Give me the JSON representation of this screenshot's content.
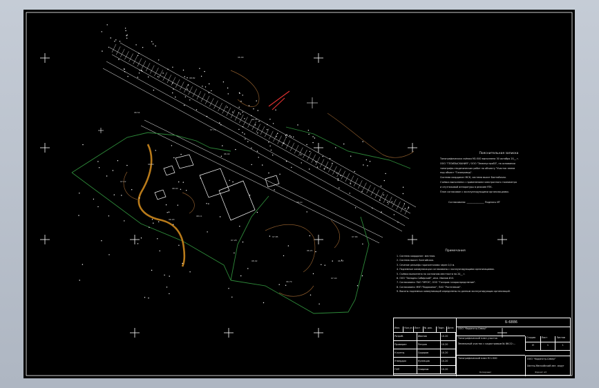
{
  "drawing": {
    "sheet_number": "Б-6886",
    "notes_title": "Пояснительная записка",
    "legend_title": "Примечания",
    "notes_lines": [
      "Топографическая съёмка М1:500 выполнена 30 октября 20__ г.",
      "ООО \"ГЕОИЗЫСКАНИЯ\" / ООО \"ЗемлеустройЗ\", на основании",
      "топографо-геодезических работ по объекту \"Участок земли",
      "под объект \"Газопровод\".",
      "Система координат МСК, система высот Балтийская.",
      "Съёмка выполнена с применением электронного тахеометра",
      "и спутниковой аппаратуры в режиме RTK.",
      "План согласован с эксплуатирующими организациями."
    ],
    "signature_line": "Согласовано: ______________ Подпись ИТ",
    "legend_lines": [
      "1. Система координат: местная.",
      "2. Система высот: Балтийская.",
      "3. Сечение рельефа горизонталями через 0,5 м.",
      "4. Подземные коммуникации согласованы с эксплуатирующими организациями.",
      "5. Съёмка выполнена по состоянию местности на 20__ г.",
      "6. ООО \"Западно-Сибирский\", инж. Иванов И.И.",
      "7. Согласовано: ПАО \"МРСК\", ООО \"Газпром газораспределение\".",
      "8. Согласовано: МУП \"Водоканал\", ПАО \"Ростелеком\".",
      "9. Высоты подземных коммуникаций определены по данным эксплуатирующих организаций."
    ],
    "title_block": {
      "company": "ООО \"Каданстр-Север\"",
      "object_name": "Топографический план участка",
      "object_desc": "Земельный участок с кадастровым № 86:22:...",
      "plan_name": "Топографический план М 1:500",
      "stage_label": "Стадия",
      "stage_value": "И",
      "sheet_label": "Лист",
      "sheet_value": "1",
      "sheets_label": "Листов",
      "sheets_value": "1",
      "org_name": "ООО \"Каданстр-Север\"",
      "org_sub": "Ханты-Мансийский авт. округ",
      "rows": [
        {
          "role": "Разраб.",
          "name": "Иванов",
          "date": "10.20"
        },
        {
          "role": "Проверил",
          "name": "Петров",
          "date": "10.20"
        },
        {
          "role": "Н.контр.",
          "name": "Сидоров",
          "date": "10.20"
        },
        {
          "role": "Утвердил",
          "name": "Кузнецов",
          "date": "10.20"
        },
        {
          "role": "ГИП",
          "name": "Смирнов",
          "date": "10.20"
        }
      ],
      "header_cols": [
        "Изм.",
        "Кол.уч",
        "Лист",
        "№ док.",
        "Подп.",
        "Дата"
      ],
      "copied": "Копировал",
      "format": "Формат А3"
    },
    "elevations": [
      "98.82",
      "96.99",
      "98.54",
      "97.71",
      "98.35",
      "98.40",
      "98.11",
      "97.85",
      "96.21",
      "97.40",
      "96.79",
      "98.02",
      "96.80",
      "97.12",
      "96.44",
      "97.66",
      "98.10",
      "96.93",
      "97.28",
      "96.57"
    ]
  },
  "colors": {
    "background": "#000000",
    "lines": "#ffffff",
    "green_boundary": "#2e8b3a",
    "contour": "#8b5a2b",
    "road": "#b87a1a",
    "red_marker": "#e03030"
  }
}
